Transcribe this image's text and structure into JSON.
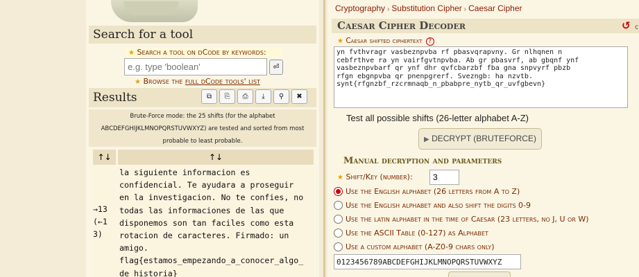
{
  "left": {
    "search": {
      "heading": "Search for a tool",
      "keyword_label": "Search a tool on dCode by keywords:",
      "placeholder": "e.g. type 'boolean'",
      "go_icon": "return-icon",
      "browse_prefix": "Browse the ",
      "browse_link": "full dCode tools' list"
    },
    "results": {
      "heading": "Results",
      "toolbar": [
        "copy-icon",
        "export-icon",
        "print-icon",
        "download-icon",
        "pin-icon",
        "close-icon"
      ],
      "info_lines": [
        "Brute-Force mode: the 25 shifts (for the alphabet",
        "ABCDEFGHIJKLMNOPQRSTUVWXYZ) are tested and sorted from most",
        "probable to least probable."
      ],
      "table": {
        "col1_header": "↑↓",
        "col2_header": "↑↓",
        "shift_lines": [
          "→13",
          "(←1",
          "3)"
        ],
        "text_lines": [
          "la siguiente informacion es",
          "confidencial. Te ayudara a proseguir",
          "en la investigacion. No te confies, no",
          "todas las informaciones de las que",
          "disponemos son tan faciles como esta",
          "rotacion de caracteres. Firmado: un",
          "amigo.",
          "flag{estamos_empezando_a_conocer_algo_",
          "de_historia}"
        ]
      }
    }
  },
  "right": {
    "breadcrumb": [
      "Cryptography",
      "Substitution Cipher",
      "Caesar Cipher"
    ],
    "title": "Caesar Cipher Decoder",
    "ciphertext_label": "Caesar shifted ciphertext",
    "ciphertext_lines": [
      "yn fvthvragr vasbeznpvba rf pbasvqrapvny. Gr nlhqnen n",
      "cebfrthve ra yn vairfgvtnpvba. Ab gr pbasvrf, ab gbqnf ynf",
      "vasbeznpvbarf qr ynf dhr qvfcbarzbf fba gna snpvyrf pbzb",
      "rfgn ebgnpvba qr pnenpgrerf. Svezngb: ha nzvtb.",
      "synt{rfgnzbf_rzcrmnaqb_n_pbabpre_nytb_qr_uvfgbevn}"
    ],
    "test_all": "Test all possible shifts (26-letter alphabet A-Z)",
    "decrypt_button": "DECRYPT (BRUTEFORCE)",
    "manual_heading": "Manual decryption and parameters",
    "shift_label": "Shift/Key (number):",
    "shift_value": "3",
    "options": [
      {
        "label": "Use the English alphabet (26 letters from A to Z)",
        "selected": true
      },
      {
        "label": "Use the English alphabet and also shift the digits 0-9",
        "selected": false
      },
      {
        "label": "Use the latin alphabet in the time of Caesar (23 letters, no J, U or W)",
        "selected": false
      },
      {
        "label": "Use the ASCII Table (0-127) as Alphabet",
        "selected": false
      },
      {
        "label": "Use a custom alphabet (A-Z0-9 chars only)",
        "selected": false
      }
    ],
    "custom_alphabet": "0123456789ABCDEFGHIJKLMNOPQRSTUVWXYZ",
    "reset_icon": "refresh-icon",
    "side_text": "c"
  },
  "colors": {
    "accent": "#8b1a00",
    "background": "#f4ecd6",
    "panel": "#fbf5e4",
    "radio_selected": "#cc0000"
  }
}
